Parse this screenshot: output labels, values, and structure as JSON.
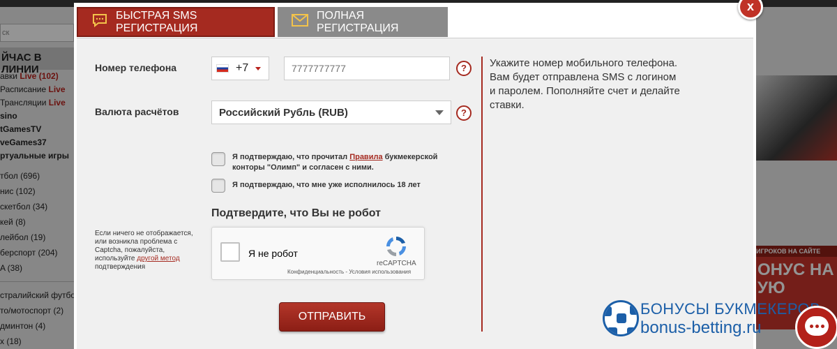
{
  "background": {
    "search_placeholder": "ск",
    "sidebar_title": "ЙЧАС В ЛИНИИ",
    "sidebar_items": [
      {
        "text": "авки ",
        "live": "Live (102)"
      },
      {
        "text": " Расписание ",
        "live": "Live"
      },
      {
        "text": " Трансляции ",
        "live": "Live"
      },
      {
        "text": "sino",
        "live": ""
      },
      {
        "text": "tGamesTV",
        "live": ""
      },
      {
        "text": "veGames37",
        "live": ""
      },
      {
        "text": "ртуальные игры",
        "live": ""
      }
    ],
    "sport_items": [
      "тбол (696)",
      "нис (102)",
      "скетбол (34)",
      "кей (8)",
      "лейбол (19)",
      "берспорт (204)",
      "A (38)"
    ],
    "sport_items_2": [
      "стралийский футбол (",
      "то/мотоспорт (2)",
      "дминтон (4)",
      "x (18)"
    ],
    "banner_top": "ИГРОКОВ НА САЙТЕ",
    "banner_big": "ОНУС НА\nУЮ"
  },
  "modal": {
    "close_label": "x",
    "tabs": [
      {
        "label": "БЫСТРАЯ SMS РЕГИСТРАЦИЯ",
        "icon": "sms-bubble-icon",
        "active": true
      },
      {
        "label": "ПОЛНАЯ РЕГИСТРАЦИЯ",
        "icon": "envelope-icon",
        "active": false
      }
    ],
    "phone": {
      "label": "Номер телефона",
      "country_code": "+7",
      "flag": "russia-flag-icon",
      "placeholder": "7777777777"
    },
    "currency": {
      "label": "Валюта расчётов",
      "selected": "Российский Рубль (RUB)"
    },
    "help_symbol": "?",
    "agree_rules": {
      "before": "Я подтверждаю, что прочитал ",
      "link": "Правила",
      "after": " букмекерской конторы \"Олимп\" и согласен с ними."
    },
    "agree_age": "Я подтверждаю, что мне уже исполнилось 18 лет",
    "robot_title": "Подтвердите, что Вы не робот",
    "captcha_note": {
      "before": "Если ничего не отображается, или возникла проблема с Captcha, пожалуйста, используйте ",
      "link": "другой метод",
      "after": " подтверждения"
    },
    "recaptcha": {
      "label": "Я не робот",
      "brand": "reCAPTCHA",
      "links": "Конфиденциальность - Условия использования"
    },
    "submit_label": "ОТПРАВИТЬ",
    "info_text": "Укажите номер мобильного телефона. Вам будет отправлена SMS с логином и паролем. Пополняйте счет и делайте ставки."
  },
  "colors": {
    "brand_red": "#a52a20",
    "watermark_blue": "#1c5fa8"
  }
}
